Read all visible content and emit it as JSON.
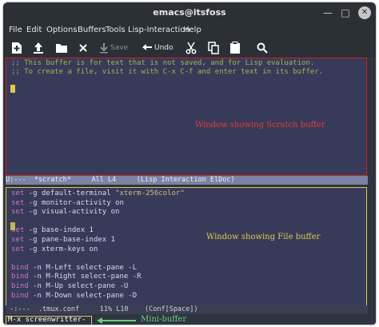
{
  "window": {
    "title": "emacs@itsfoss"
  },
  "menubar": [
    "File",
    "Edit",
    "Options",
    "Buffers",
    "Tools",
    "Lisp-Interaction",
    "Help"
  ],
  "toolbar": {
    "new_icon": "new-file-icon",
    "open_icon": "open-file-icon",
    "folder_icon": "folder-icon",
    "close_icon": "close-icon",
    "save_label": "Save",
    "undo_label": "Undo",
    "cut_icon": "scissors-icon",
    "copy_icon": "copy-icon",
    "paste_icon": "paste-icon",
    "search_icon": "search-icon"
  },
  "scratch": {
    "lines": [
      ";; This buffer is for text that is not saved, and for Lisp evaluation.",
      ";; To create a file, visit it with C-x C-f and enter text in its buffer."
    ],
    "annotation": "Window showing Scratch buffer"
  },
  "modeline1": {
    "text": "U:---  *scratch*     All L4     (Lisp Interaction ElDoc)"
  },
  "file": {
    "lines": [
      {
        "kw": "set",
        "rest": " -g default-terminal ",
        "str": "\"xterm-256color\""
      },
      {
        "kw": "set",
        "rest": " -g monitor-activity on",
        "str": ""
      },
      {
        "kw": "set",
        "rest": " -g visual-activity on",
        "str": ""
      },
      {
        "kw": "",
        "rest": "",
        "str": ""
      },
      {
        "kw": "set",
        "rest": " -g base-index 1",
        "str": ""
      },
      {
        "kw": "set",
        "rest": " -g pane-base-index 1",
        "str": ""
      },
      {
        "kw": "set",
        "rest": " -g xterm-keys on",
        "str": ""
      },
      {
        "kw": "",
        "rest": "",
        "str": ""
      },
      {
        "kw": "bind",
        "rest": " -n M-Left select-pane -L",
        "str": ""
      },
      {
        "kw": "bind",
        "rest": " -n M-Right select-pane -R",
        "str": ""
      },
      {
        "kw": "bind",
        "rest": " -n M-Up select-pane -U",
        "str": ""
      },
      {
        "kw": "bind",
        "rest": " -n M-Down select-pane -D",
        "str": ""
      }
    ],
    "annotation": "Window showing File buffer"
  },
  "modeline2": {
    "text": " -:---  .tmux.conf     11% L10    (Conf[Space])"
  },
  "minibuffer": {
    "text": "M-x screenwritter-",
    "label": "Mini-buffer"
  },
  "colors": {
    "scratch_border": "#d21f1f",
    "file_border": "#e3c64f",
    "minibuffer_arrow": "#6ad27a"
  }
}
